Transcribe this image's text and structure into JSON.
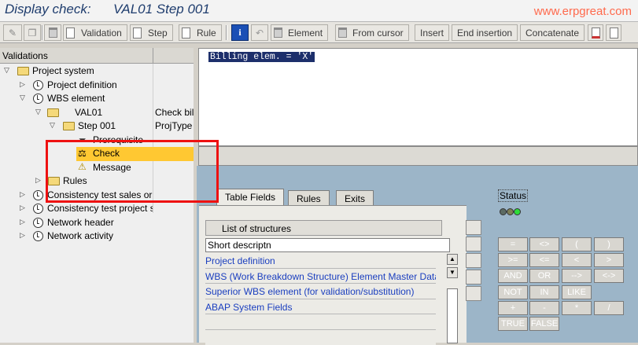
{
  "title": {
    "prefix": "Display check:",
    "name": "VAL01 Step 001"
  },
  "watermark": "www.erpgreat.com",
  "toolbar": {
    "validation": "Validation",
    "step": "Step",
    "rule": "Rule",
    "element": "Element",
    "from_cursor": "From cursor",
    "insert": "Insert",
    "end_insertion": "End insertion",
    "concatenate": "Concatenate"
  },
  "tree": {
    "header": "Validations",
    "rows": [
      {
        "label": "Project system",
        "col2": ""
      },
      {
        "label": "Project definition",
        "col2": ""
      },
      {
        "label": "WBS element",
        "col2": ""
      },
      {
        "label": "VAL01",
        "col2": "Check bil"
      },
      {
        "label": "Step 001",
        "col2": "ProjType"
      },
      {
        "label": "Prerequisite",
        "col2": ""
      },
      {
        "label": "Check",
        "col2": ""
      },
      {
        "label": "Message",
        "col2": ""
      },
      {
        "label": "Rules",
        "col2": ""
      },
      {
        "label": "Consistency test sales or",
        "col2": ""
      },
      {
        "label": "Consistency test project s",
        "col2": ""
      },
      {
        "label": "Network header",
        "col2": ""
      },
      {
        "label": "Network activity",
        "col2": ""
      }
    ]
  },
  "editor": {
    "line1": "Billing elem. = 'X'"
  },
  "tabs": {
    "table_fields": "Table Fields",
    "rules": "Rules",
    "exits": "Exits"
  },
  "structures": {
    "title": "List of structures",
    "column": "Short descriptn",
    "items": [
      "Project definition",
      "WBS (Work Breakdown Structure) Element Master Data",
      "Superior WBS element (for validation/substitution)",
      "ABAP System Fields"
    ]
  },
  "status": {
    "label": "Status"
  },
  "operators": [
    "=",
    "<>",
    "(",
    ")",
    ">=",
    "<=",
    "<",
    ">",
    "AND",
    "OR",
    "-->",
    "<->",
    "NOT",
    "IN",
    "LIKE",
    "",
    "+",
    "-",
    "*",
    "/",
    "TRUE",
    "FALSE",
    "",
    ""
  ],
  "colors": {
    "highlight": "#ffc832",
    "redbox": "#ee1111",
    "link": "#1a3ebf",
    "pane_bg": "#9cb5c8"
  }
}
